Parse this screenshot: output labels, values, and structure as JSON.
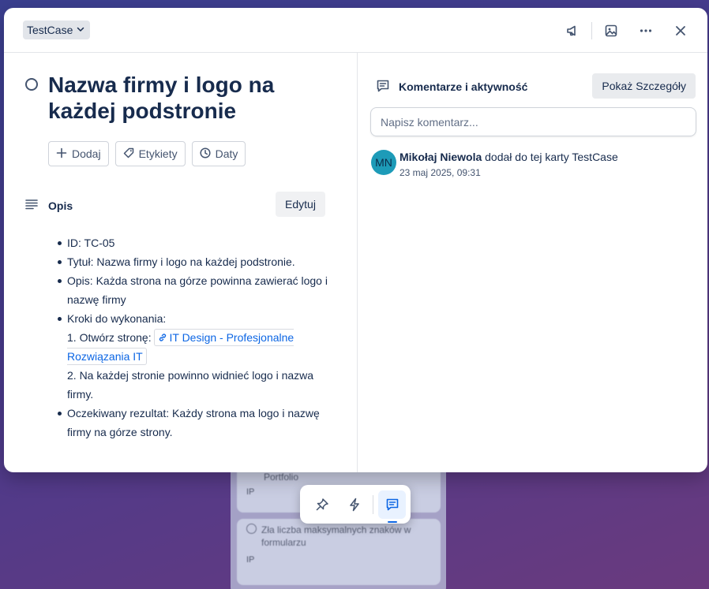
{
  "background": {
    "cards": [
      {
        "label": "Portfolio",
        "tag": "IP"
      },
      {
        "label": "Zła liczba maksymalnych znaków w formularzu",
        "tag": "IP"
      }
    ]
  },
  "header": {
    "list_name": "TestCase",
    "icons": [
      "megaphone-icon",
      "image-icon",
      "more-icon",
      "close-icon"
    ]
  },
  "card": {
    "title": "Nazwa firmy i logo na każdej podstronie",
    "actions": {
      "add": "Dodaj",
      "labels": "Etykiety",
      "dates": "Daty"
    },
    "description": {
      "heading": "Opis",
      "edit_label": "Edytuj",
      "items": {
        "id": "ID: TC-05",
        "title": "Tytuł: Nazwa firmy i logo na każdej podstronie.",
        "desc": "Opis: Każda strona na górze powinna zawierać logo i nazwę firmy",
        "steps_heading": "Kroki do wykonania:",
        "step1_prefix": "1. Otwórz stronę:",
        "step1_link": "IT Design - Profesjonalne Rozwiązania IT",
        "step2": "2. Na każdej stronie powinno widnieć logo i nazwa firmy.",
        "expected": "Oczekiwany rezultat: Każdy strona ma logo i nazwę firmy na górze strony."
      }
    }
  },
  "comments": {
    "heading": "Komentarze i aktywność",
    "details_button": "Pokaż Szczegóły",
    "input_placeholder": "Napisz komentarz...",
    "activity": [
      {
        "initials": "MN",
        "user": "Mikołaj Niewola",
        "action": "dodał do tej karty TestCase",
        "time": "23 maj 2025, 09:31"
      }
    ]
  },
  "colors": {
    "accent": "#0c66e4",
    "avatar": "#1d9bb8",
    "text": "#172b4d"
  }
}
